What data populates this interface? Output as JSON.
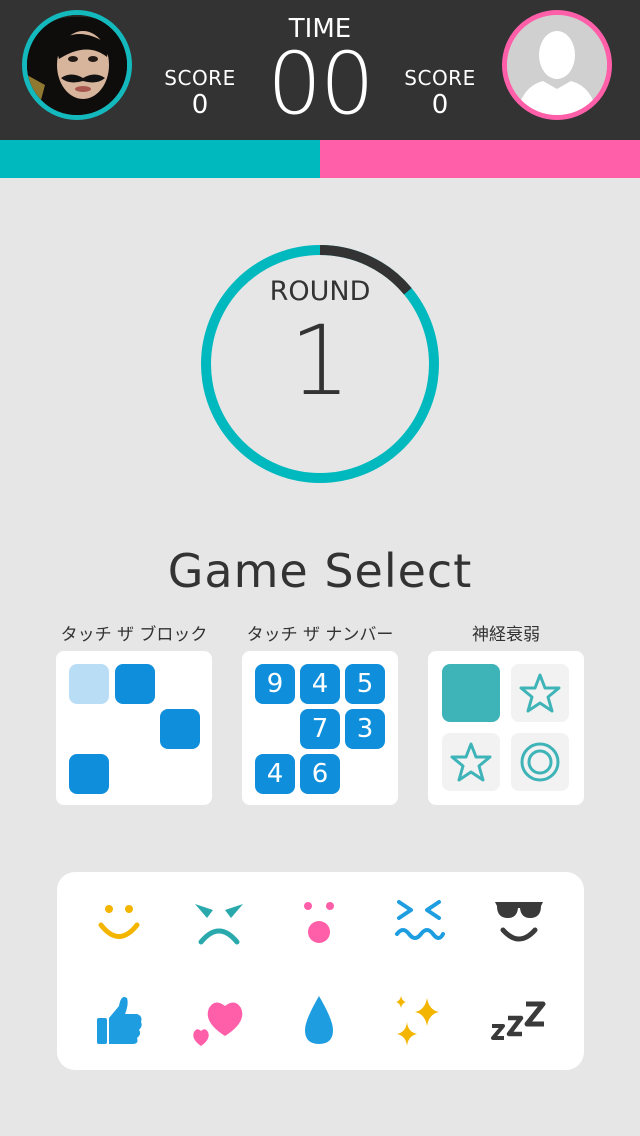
{
  "header": {
    "time_label": "TIME",
    "time_value": "00",
    "player1": {
      "score_label": "SCORE",
      "score_value": "0"
    },
    "player2": {
      "score_label": "SCORE",
      "score_value": "0"
    }
  },
  "round": {
    "label": "ROUND",
    "number": "1",
    "progress": 0.14
  },
  "game_select": {
    "title": "Game Select",
    "games": [
      {
        "label": "タッチ ザ ブロック"
      },
      {
        "label": "タッチ ザ ナンバー",
        "numbers": [
          "9",
          "4",
          "5",
          "7",
          "3",
          "4",
          "6"
        ]
      },
      {
        "label": "神経衰弱"
      }
    ]
  },
  "emoji_icons": [
    "smile-icon",
    "angry-icon",
    "surprised-icon",
    "dizzy-icon",
    "sunglasses-icon",
    "thumbs-up-icon",
    "hearts-icon",
    "drop-icon",
    "sparkles-icon",
    "zzz-icon"
  ],
  "colors": {
    "header": "#333333",
    "player1": "#00b9be",
    "player2": "#ff5ea8",
    "accent_blue": "#0f8fdb",
    "background": "#e6e6e6"
  }
}
